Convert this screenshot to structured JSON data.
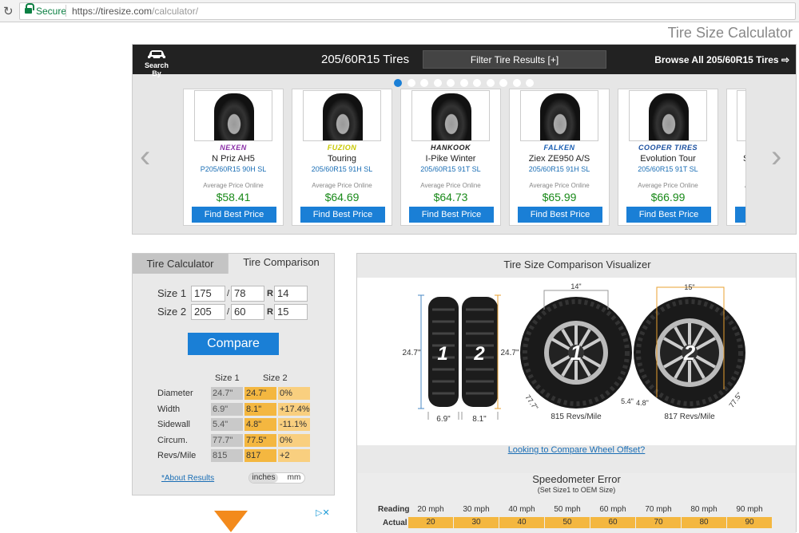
{
  "browser": {
    "secure": "Secure",
    "url_host": "https://tiresize.com",
    "url_path": "/calculator/"
  },
  "page_title": "Tire Size Calculator",
  "carousel": {
    "search_by": "Search By",
    "title": "205/60R15 Tires",
    "filter": "Filter Tire Results [+]",
    "browse": "Browse All 205/60R15 Tires ⇨",
    "dot_count": 11,
    "cards": [
      {
        "brand": "NEXEN",
        "brand_color": "#8b2fa8",
        "name": "N Priz AH5",
        "size": "P205/60R15 90H SL",
        "avg": "Average Price Online",
        "price": "$58.41",
        "button": "Find Best Price"
      },
      {
        "brand": "FUZION",
        "brand_color": "#c8c800",
        "name": "Touring",
        "size": "205/60R15 91H SL",
        "avg": "Average Price Online",
        "price": "$64.69",
        "button": "Find Best Price"
      },
      {
        "brand": "HANKOOK",
        "brand_color": "#222222",
        "name": "I-Pike Winter",
        "size": "205/60R15 91T SL",
        "avg": "Average Price Online",
        "price": "$64.73",
        "button": "Find Best Price"
      },
      {
        "brand": "FALKEN",
        "brand_color": "#1a5fb4",
        "name": "Ziex ZE950 A/S",
        "size": "205/60R15 91H SL",
        "avg": "Average Price Online",
        "price": "$65.99",
        "button": "Find Best Price"
      },
      {
        "brand": "COOPER TIRES",
        "brand_color": "#1a4fa0",
        "name": "Evolution Tour",
        "size": "205/60R15 91T SL",
        "avg": "Average Price Online",
        "price": "$66.99",
        "button": "Find Best Price"
      },
      {
        "name": "Si",
        "avg": "A"
      }
    ]
  },
  "calc": {
    "tab_calculator": "Tire Calculator",
    "tab_comparison": "Tire Comparison",
    "size1_label": "Size 1",
    "size2_label": "Size 2",
    "size1": {
      "width": "175",
      "aspect": "78",
      "rim": "14"
    },
    "size2": {
      "width": "205",
      "aspect": "60",
      "rim": "15"
    },
    "slash": "/",
    "r": "R",
    "compare": "Compare",
    "col1": "Size 1",
    "col2": "Size 2",
    "rows": [
      {
        "label": "Diameter",
        "s1": "24.7\"",
        "s2": "24.7\"",
        "diff": "0%"
      },
      {
        "label": "Width",
        "s1": "6.9\"",
        "s2": "8.1\"",
        "diff": "+17.4%"
      },
      {
        "label": "Sidewall",
        "s1": "5.4\"",
        "s2": "4.8\"",
        "diff": "-11.1%"
      },
      {
        "label": "Circum.",
        "s1": "77.7\"",
        "s2": "77.5\"",
        "diff": "0%"
      },
      {
        "label": "Revs/Mile",
        "s1": "815",
        "s2": "817",
        "diff": "+2"
      }
    ],
    "about": "*About Results",
    "unit_inches": "inches",
    "unit_mm": "mm"
  },
  "viz": {
    "title": "Tire Size Comparison Visualizer",
    "dia1": "24.7\"",
    "dia2": "24.7\"",
    "w1": "6.9\"",
    "w2": "8.1\"",
    "num1": "1",
    "num2": "2",
    "rim1": "14\"",
    "rim2": "15\"",
    "side1": "5.4\"",
    "side2": "4.8\"",
    "circ1": "77.7\"",
    "circ2": "77.5\"",
    "revs1": "815 Revs/Mile",
    "revs2": "817 Revs/Mile",
    "link": "Looking to Compare Wheel Offset?"
  },
  "speedo": {
    "title": "Speedometer Error",
    "subtitle": "(Set Size1 to OEM Size)",
    "reading_label": "Reading",
    "actual_label": "Actual",
    "reading": [
      "20 mph",
      "30 mph",
      "40 mph",
      "50 mph",
      "60 mph",
      "70 mph",
      "80 mph",
      "90 mph"
    ],
    "actual": [
      "20",
      "30",
      "40",
      "50",
      "60",
      "70",
      "80",
      "90"
    ]
  },
  "ad": {
    "close": "▷✕"
  },
  "colors": {
    "accent": "#1a7fd6",
    "price": "#1a8a1a",
    "highlight": "#f4b740"
  }
}
